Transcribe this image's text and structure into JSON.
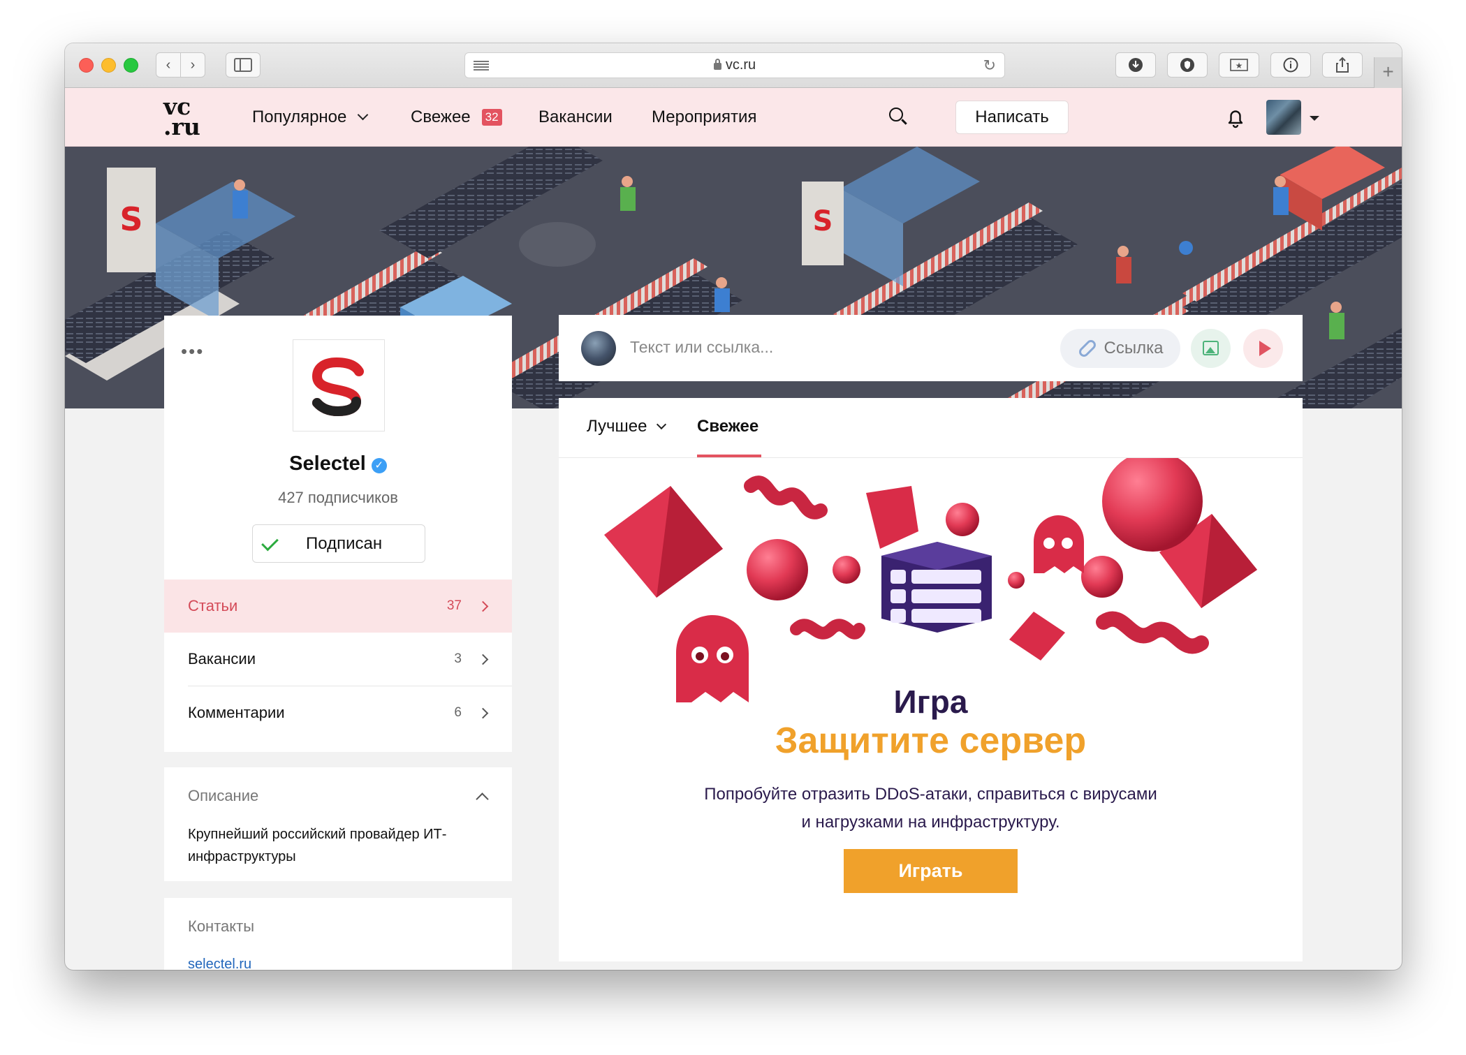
{
  "browser": {
    "url": "vc.ru",
    "nav_back_icon": "chevron-left-icon",
    "nav_forward_icon": "chevron-right-icon",
    "sidebar_icon": "sidebar-icon",
    "toolbar_icons": [
      "download-icon",
      "shield-icon",
      "bookmark-star-icon",
      "info-icon",
      "share-icon"
    ],
    "new_tab": "+"
  },
  "header": {
    "logo_line1": "vc",
    "logo_line2": ".ru",
    "nav": [
      {
        "label": "Популярное",
        "has_dropdown": true
      },
      {
        "label": "Свежее",
        "badge": "32"
      },
      {
        "label": "Вакансии"
      },
      {
        "label": "Мероприятия"
      }
    ],
    "write_button": "Написать",
    "icons": {
      "search": "search-icon",
      "notifications": "bell-icon",
      "menu": "caret-down-icon"
    }
  },
  "profile": {
    "more_label": "•••",
    "name": "Selectel",
    "verified": true,
    "subscribers": "427 подписчиков",
    "subscribe_button": "Подписан",
    "logo_letter": "S",
    "menu": [
      {
        "label": "Статьи",
        "count": "37",
        "active": true
      },
      {
        "label": "Вакансии",
        "count": "3",
        "active": false
      },
      {
        "label": "Комментарии",
        "count": "6",
        "active": false
      }
    ]
  },
  "description": {
    "title": "Описание",
    "text": "Крупнейший российский провайдер ИТ-инфраструктуры"
  },
  "contacts": {
    "title": "Контакты",
    "link": "selectel.ru"
  },
  "composer": {
    "placeholder": "Текст или ссылка...",
    "link_button": "Ссылка"
  },
  "feed": {
    "tabs": [
      {
        "label": "Лучшее",
        "has_dropdown": true,
        "active": false
      },
      {
        "label": "Свежее",
        "active": true
      }
    ],
    "promo": {
      "title": "Игра",
      "subtitle": "Защитите сервер",
      "text": "Попробуйте отразить DDoS-атаки, справиться с вирусами и нагрузками на инфраструктуру.",
      "button": "Играть"
    }
  },
  "colors": {
    "accent": "#e35360",
    "header_bg": "#fbe7e9",
    "promo_orange": "#f0a12b",
    "promo_text": "#2a1a4c",
    "verified": "#3c9ff6"
  }
}
